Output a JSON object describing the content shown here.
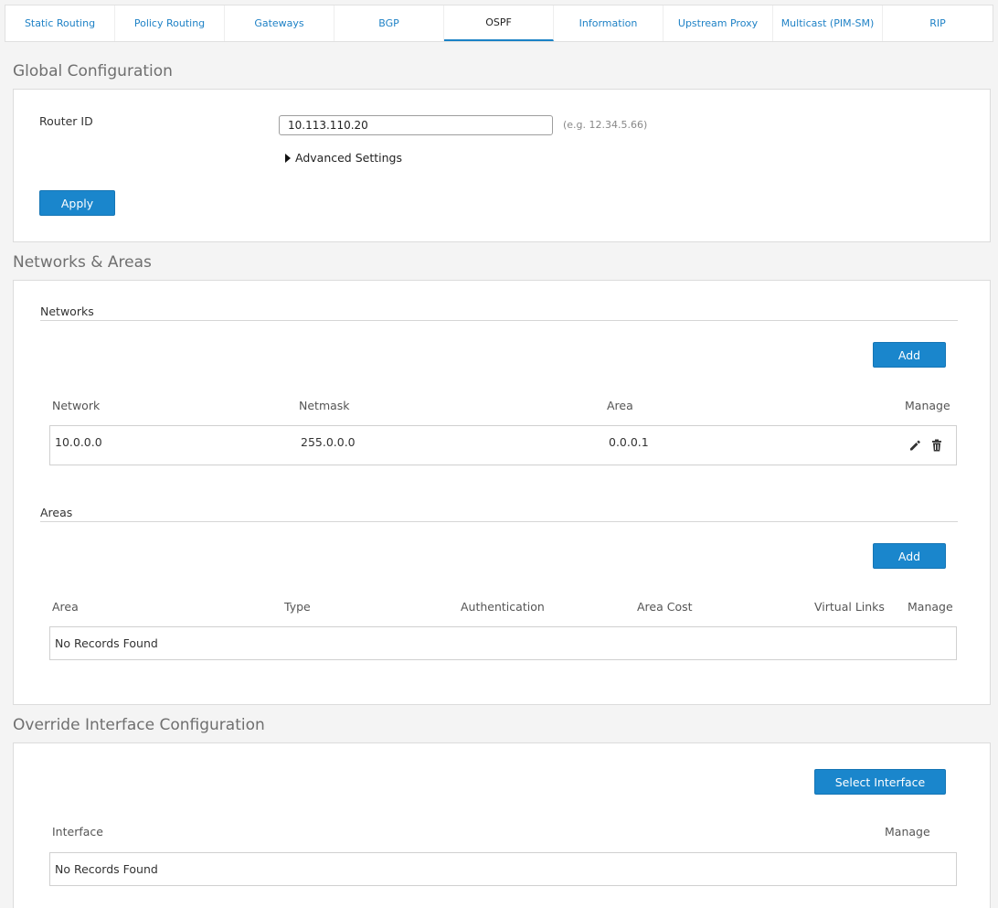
{
  "tabs": [
    {
      "label": "Static Routing",
      "active": false
    },
    {
      "label": "Policy Routing",
      "active": false
    },
    {
      "label": "Gateways",
      "active": false
    },
    {
      "label": "BGP",
      "active": false
    },
    {
      "label": "OSPF",
      "active": true
    },
    {
      "label": "Information",
      "active": false
    },
    {
      "label": "Upstream Proxy",
      "active": false
    },
    {
      "label": "Multicast (PIM-SM)",
      "active": false
    },
    {
      "label": "RIP",
      "active": false
    }
  ],
  "global_config": {
    "title": "Global Configuration",
    "router_id_label": "Router ID",
    "router_id_value": "10.113.110.20",
    "router_id_hint": "(e.g. 12.34.5.66)",
    "advanced_settings": "Advanced Settings",
    "apply_label": "Apply"
  },
  "networks_areas": {
    "title": "Networks & Areas",
    "networks": {
      "title": "Networks",
      "add_label": "Add",
      "columns": [
        "Network",
        "Netmask",
        "Area",
        "Manage"
      ],
      "rows": [
        {
          "network": "10.0.0.0",
          "netmask": "255.0.0.0",
          "area": "0.0.0.1"
        }
      ]
    },
    "areas": {
      "title": "Areas",
      "add_label": "Add",
      "columns": [
        "Area",
        "Type",
        "Authentication",
        "Area Cost",
        "Virtual Links",
        "Manage"
      ],
      "empty_text": "No Records Found"
    }
  },
  "override_interface": {
    "title": "Override Interface Configuration",
    "select_label": "Select Interface",
    "columns": [
      "Interface",
      "Manage"
    ],
    "empty_text": "No Records Found"
  },
  "colors": {
    "accent": "#1a86cc",
    "tab_text": "#1f82c6",
    "background": "#f4f4f4"
  },
  "icons": [
    "edit-pencil-icon",
    "trash-icon",
    "caret-right-icon"
  ]
}
